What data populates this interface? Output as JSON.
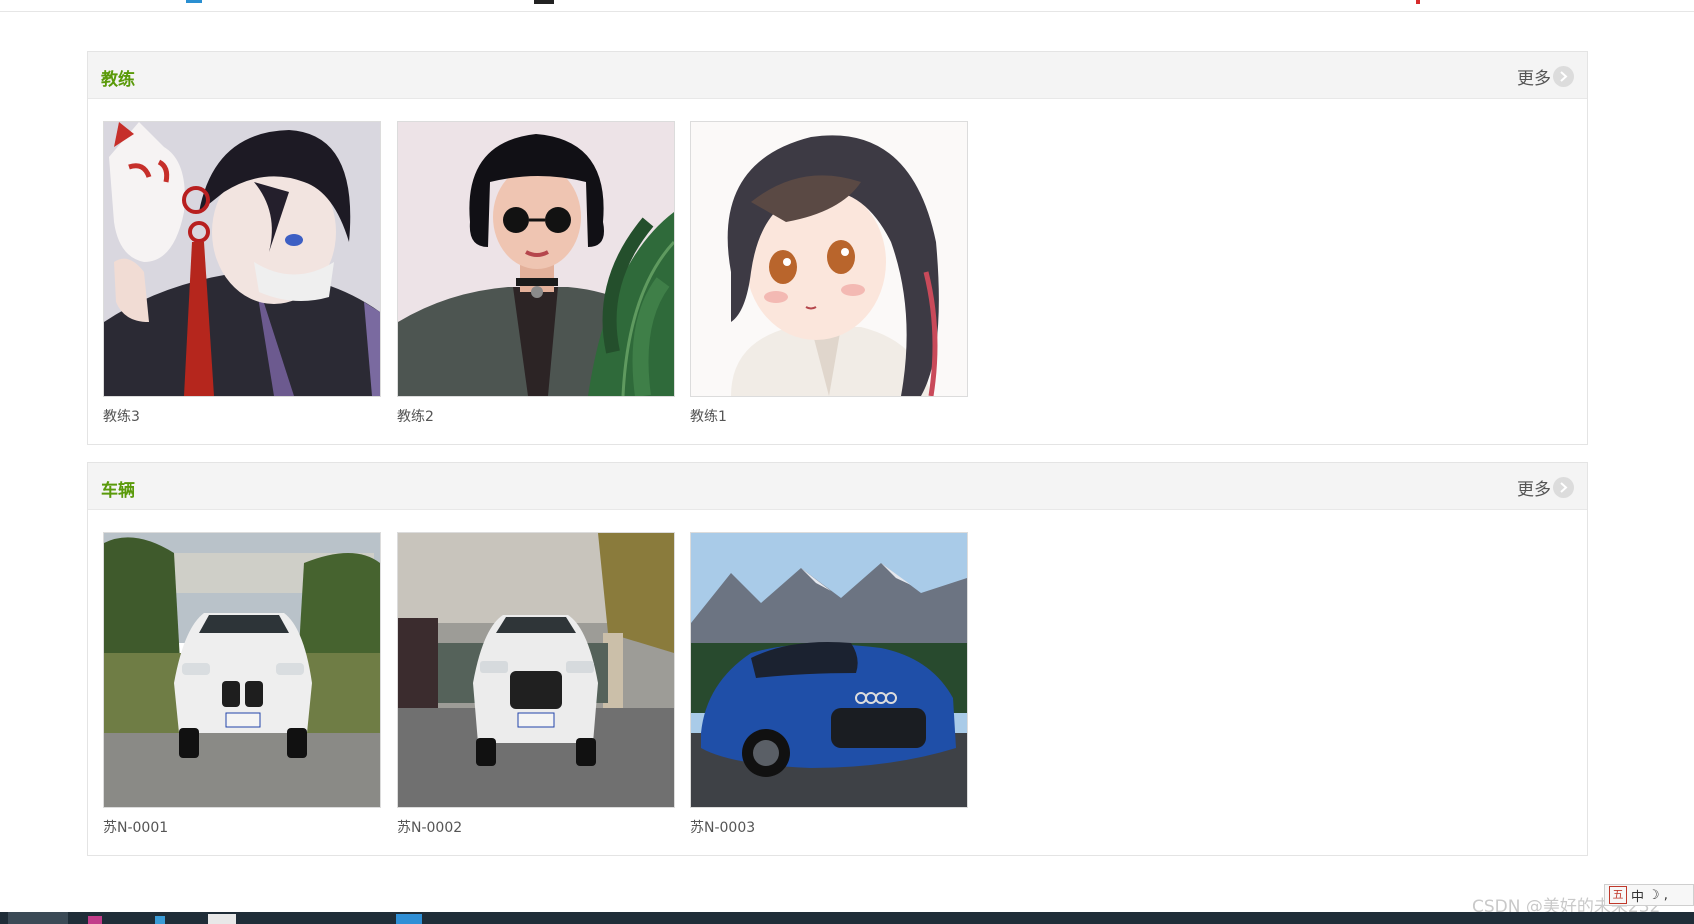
{
  "sections": [
    {
      "title": "教练",
      "more_label": "更多",
      "items": [
        {
          "caption": "教练3",
          "image": "anime-boy-fox-mask"
        },
        {
          "caption": "教练2",
          "image": "bob-hair-sunglasses-woman"
        },
        {
          "caption": "教练1",
          "image": "anime-girl-brown-hair"
        }
      ]
    },
    {
      "title": "车辆",
      "more_label": "更多",
      "items": [
        {
          "caption": "苏N-0001",
          "image": "white-bmw-suv"
        },
        {
          "caption": "苏N-0002",
          "image": "white-audi-suv"
        },
        {
          "caption": "苏N-0003",
          "image": "blue-audi-sportback"
        }
      ]
    }
  ],
  "overlay": {
    "watermark": "CSDN @美好的未来232",
    "ime_label": "五",
    "ime_mode": "中",
    "ime_extra": "☽ ,"
  },
  "colors": {
    "section_title": "#5a9a0a",
    "panel_header": "#f4f4f4",
    "taskbar": "#1f2d38"
  }
}
